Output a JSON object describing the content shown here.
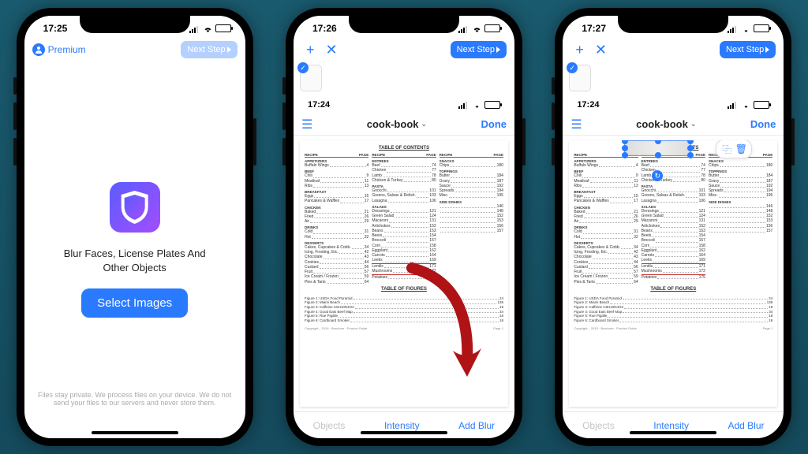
{
  "phone1": {
    "time": "17:25",
    "premium_label": "Premium",
    "next_label": "Next Step",
    "tagline_l1": "Blur Faces, License Plates And",
    "tagline_l2": "Other Objects",
    "select_label": "Select Images",
    "disclaimer": "Files stay private. We process files on your device. We do not send your files to our servers and never store them."
  },
  "phone2": {
    "time": "17:26",
    "next_label": "Next Step"
  },
  "phone3": {
    "time": "17:27",
    "next_label": "Next Step"
  },
  "inner": {
    "time": "17:24",
    "doc_title": "cook-book",
    "done_label": "Done",
    "toc_title": "TABLE OF CONTENTS",
    "tof_title": "TABLE OF FIGURES",
    "col_recipe": "RECIPE",
    "col_page": "PAGE",
    "footer_left": "Copyright – 2019 · Brochure · Product Guide",
    "footer_right": "Page 1",
    "sections": {
      "col1": [
        {
          "head": "APPETIZERS",
          "rows": [
            [
              "Buffalo Wings",
              "4"
            ]
          ]
        },
        {
          "head": "BEEF",
          "rows": [
            [
              "Chili",
              "9"
            ],
            [
              "Meatloaf",
              "11"
            ],
            [
              "Ribs",
              "13"
            ]
          ]
        },
        {
          "head": "BREAKFAST",
          "rows": [
            [
              "Eggs",
              "15"
            ],
            [
              "Pancakes & Waffles",
              "17"
            ]
          ]
        },
        {
          "head": "CHICKEN",
          "rows": [
            [
              "Baked",
              "21"
            ],
            [
              "Fried",
              "26"
            ],
            [
              "Air",
              "29"
            ]
          ]
        },
        {
          "head": "DRINKS",
          "rows": [
            [
              "Cold",
              "31"
            ],
            [
              "Hot",
              "32"
            ]
          ]
        },
        {
          "head": "DESSERTS",
          "rows": [
            [
              "Cakes, Cupcakes & Cobb.",
              "34"
            ],
            [
              "Icing, Frosting, Etc.",
              "42"
            ],
            [
              "Chocolate",
              "43"
            ],
            [
              "Cookies",
              "44"
            ],
            [
              "Custard",
              "56"
            ],
            [
              "Fruit",
              "57"
            ],
            [
              "Ice Cream / Frozen",
              "59"
            ],
            [
              "Pies & Tarts",
              "64"
            ]
          ]
        }
      ],
      "col2": [
        {
          "head": "ENTREES",
          "rows": [
            [
              "Beef",
              "74"
            ],
            [
              "Chicken",
              "77"
            ],
            [
              "Lamb",
              "78"
            ],
            [
              "Chicken & Turkey",
              "80"
            ]
          ]
        },
        {
          "head": "PASTA",
          "rows": [
            [
              "Gnocchi",
              "101"
            ],
            [
              "Greens, Salsas & Relish.",
              "103"
            ],
            [
              "Lasagna",
              "106"
            ]
          ]
        },
        {
          "head": "SALADS",
          "rows": [
            [
              "Dressings",
              "121"
            ],
            [
              "Green Salad",
              "124"
            ],
            [
              "Macaroni",
              "131"
            ]
          ]
        },
        {
          "head": "",
          "rows": [
            [
              "Artichokes",
              "152"
            ],
            [
              "Beans",
              "153"
            ],
            [
              "Beets",
              "154"
            ],
            [
              "Broccoli",
              "157"
            ],
            [
              "Corn",
              "158"
            ],
            [
              "Eggplant",
              "162"
            ],
            [
              "Carrots",
              "164"
            ],
            [
              "Leeks",
              "169"
            ],
            [
              "Lentils",
              "171"
            ],
            [
              "Mushrooms",
              "172"
            ],
            [
              "Potatoes",
              "175"
            ]
          ]
        }
      ],
      "col3": [
        {
          "head": "SNACKS",
          "rows": [
            [
              "Chips",
              "180"
            ]
          ]
        },
        {
          "head": "TOPPINGS",
          "rows": [
            [
              "Butter",
              "184"
            ],
            [
              "Gravy",
              "187"
            ],
            [
              "Sauce",
              "192"
            ],
            [
              "Spreads",
              "194"
            ],
            [
              "Misc.",
              "195"
            ]
          ]
        },
        {
          "head": "SIDE DISHES",
          "rows": [
            [
              "",
              "146"
            ],
            [
              "",
              "148"
            ],
            [
              "",
              "152"
            ],
            [
              "",
              "153"
            ],
            [
              "",
              "156"
            ],
            [
              "",
              "157"
            ]
          ]
        }
      ]
    },
    "figures": [
      [
        "Figure 1: USDA Food Pyramid",
        "24"
      ],
      [
        "Figure 2: Miami Beach",
        "138"
      ],
      [
        "Figure 3: Caffeine C8H10N4O2",
        "19"
      ],
      [
        "Figure 4: Good Eats Beef Map",
        "34"
      ],
      [
        "Figure 5: Rue Pigalle",
        "18"
      ],
      [
        "Figure 6: Cardboard Smoker",
        "18"
      ]
    ],
    "redlines_after": [
      "Leeks",
      "Mushrooms"
    ]
  },
  "tabs": {
    "objects": "Objects",
    "intensity": "Intensity",
    "addblur": "Add Blur"
  }
}
